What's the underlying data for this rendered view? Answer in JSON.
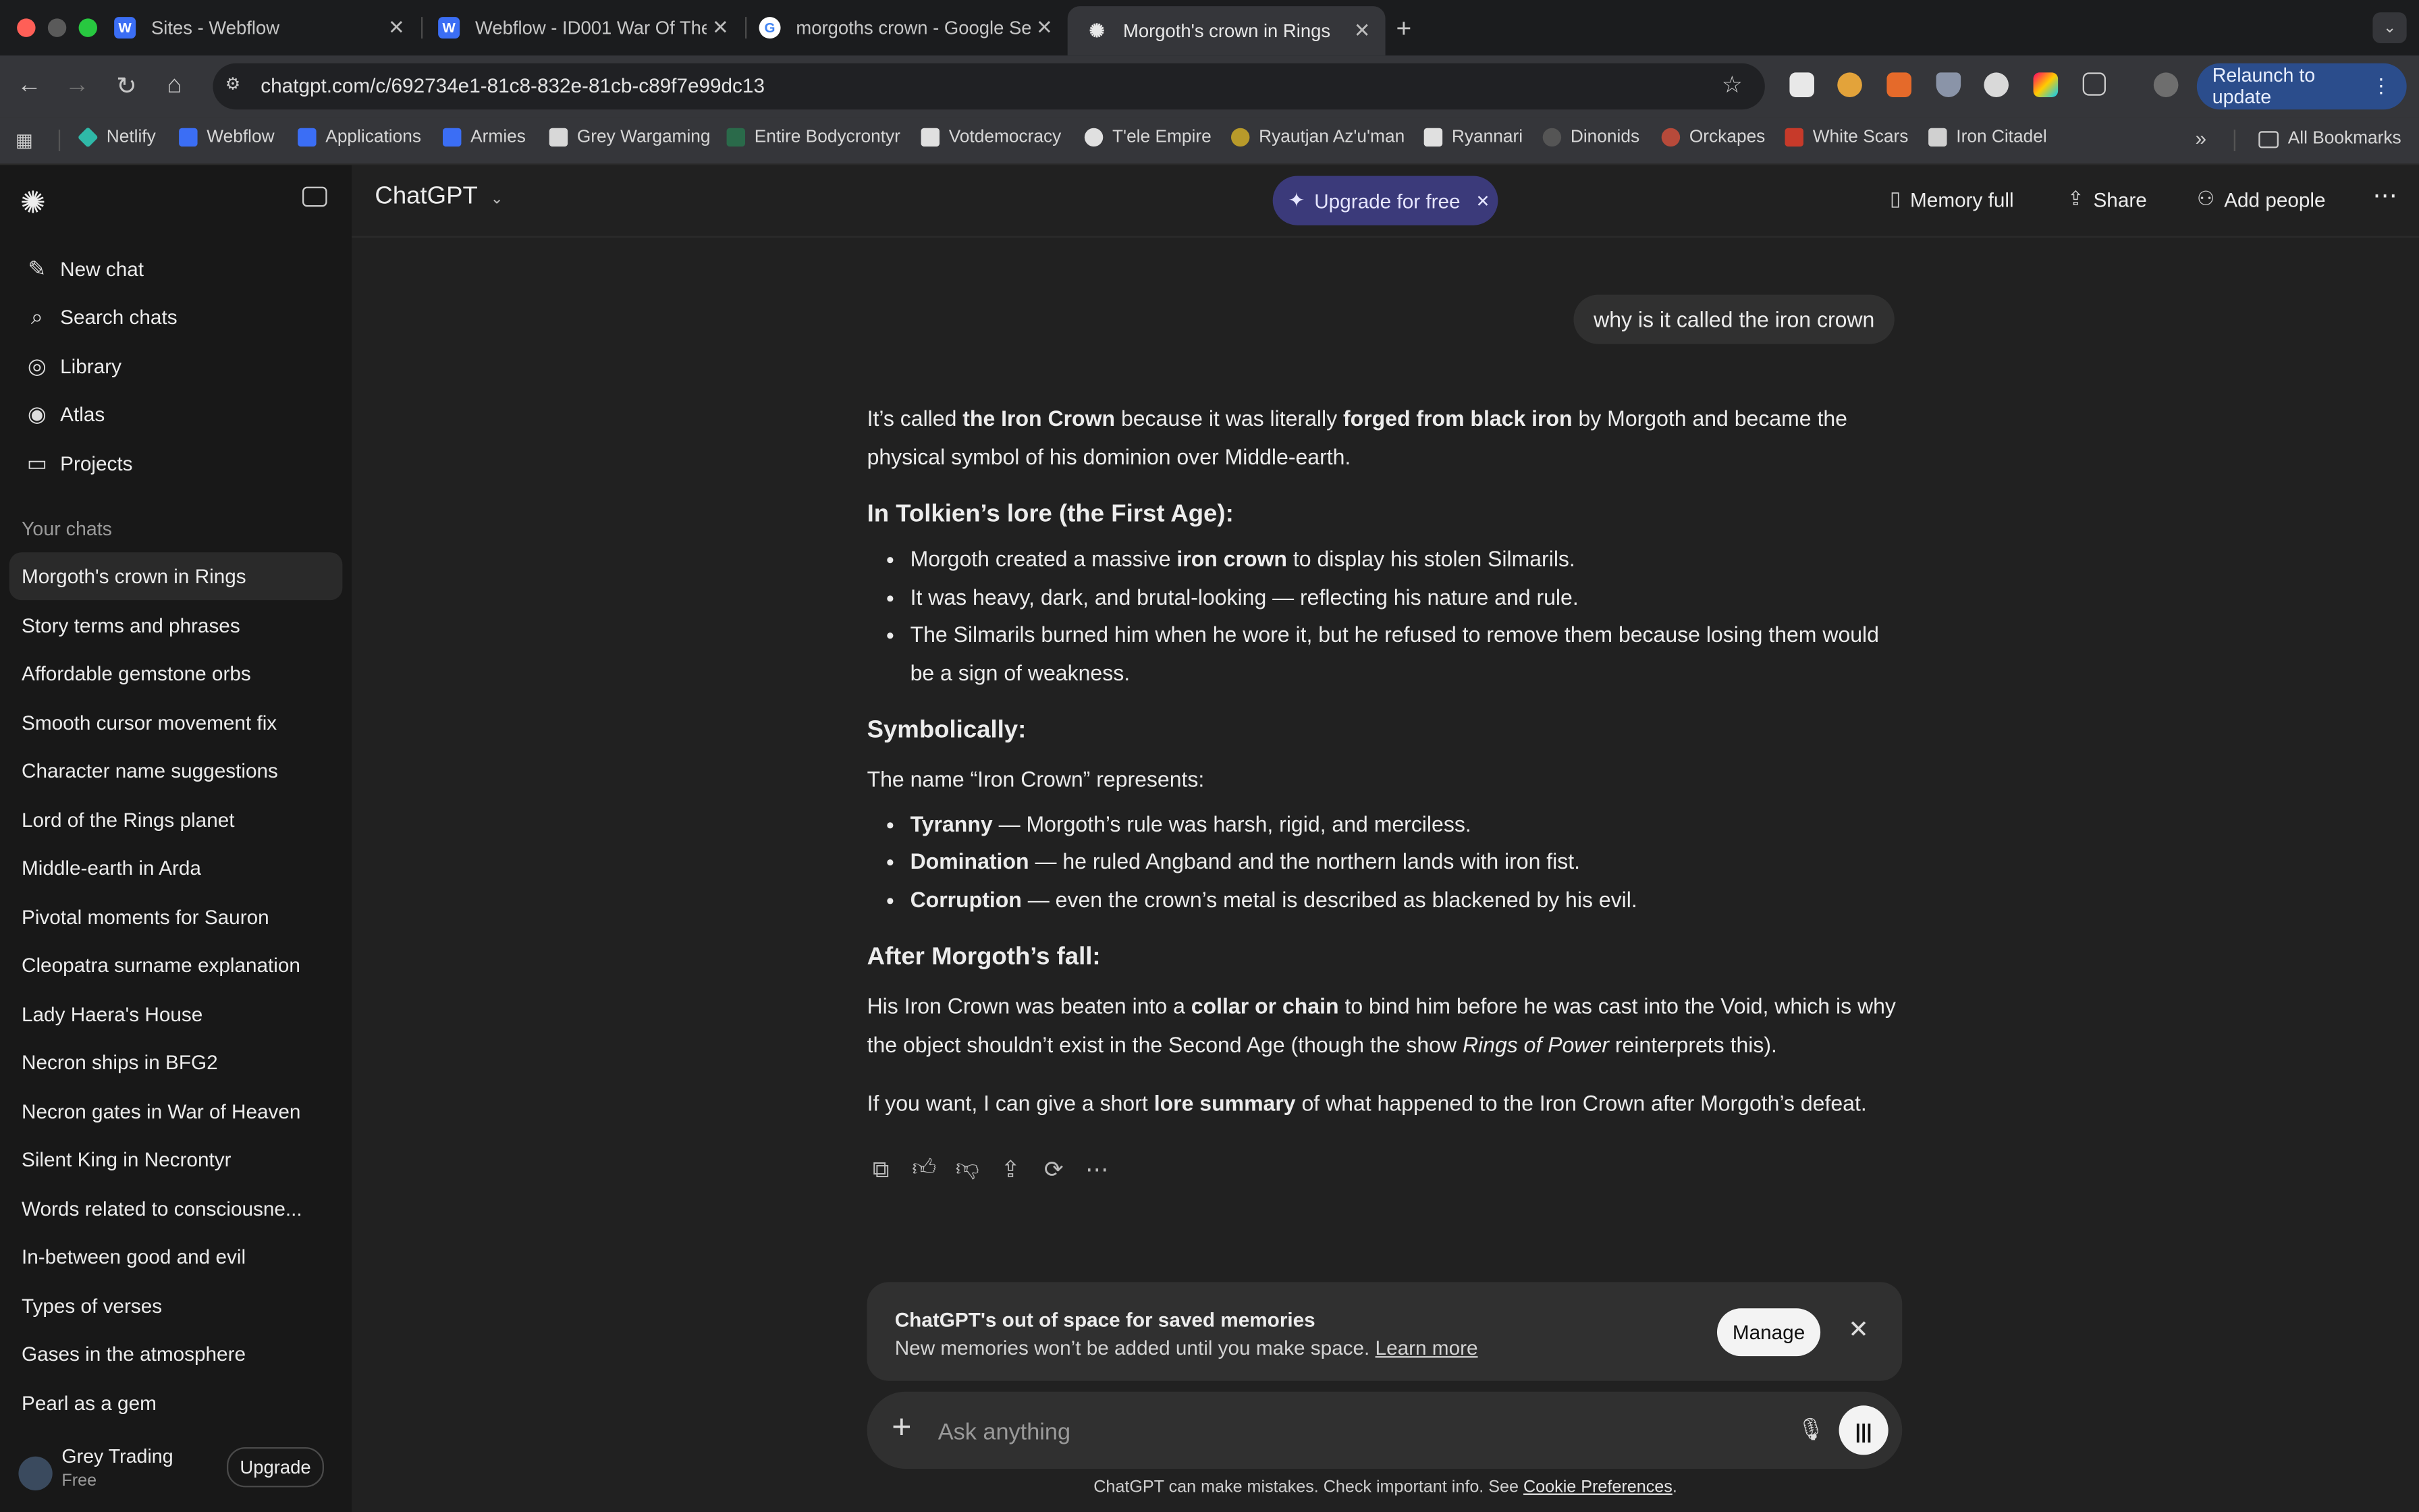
{
  "browser": {
    "tabs": [
      {
        "title": "Sites - Webflow",
        "active": false
      },
      {
        "title": "Webflow - ID001 War Of The ",
        "active": false
      },
      {
        "title": "morgoths crown - Google Sea",
        "active": false
      },
      {
        "title": "Morgoth's crown in Rings",
        "active": true
      }
    ],
    "url": "chatgpt.com/c/692734e1-81c8-832e-81cb-c89f7e99dc13",
    "relaunch_label": "Relaunch to update",
    "bookmarks": [
      "Netlify",
      "Webflow",
      "Applications",
      "Armies",
      "Grey Wargaming",
      "Entire Bodycrontyr",
      "Votdemocracy",
      "T'ele Empire",
      "Ryautjan Az'u'man",
      "Ryannari",
      "Dinonids",
      "Orckapes",
      "White Scars",
      "Iron Citadel"
    ],
    "all_bookmarks": "All Bookmarks",
    "overflow": "»"
  },
  "sidebar": {
    "nav": [
      {
        "label": "New chat",
        "icon": "edit-icon"
      },
      {
        "label": "Search chats",
        "icon": "search-icon"
      },
      {
        "label": "Library",
        "icon": "library-icon"
      },
      {
        "label": "Atlas",
        "icon": "atlas-icon"
      },
      {
        "label": "Projects",
        "icon": "folder-icon"
      }
    ],
    "chats_heading": "Your chats",
    "chats": [
      "Morgoth's crown in Rings",
      "Story terms and phrases",
      "Affordable gemstone orbs",
      "Smooth cursor movement fix",
      "Character name suggestions",
      "Lord of the Rings planet",
      "Middle-earth in Arda",
      "Pivotal moments for Sauron",
      "Cleopatra surname explanation",
      "Lady Haera's House",
      "Necron ships in BFG2",
      "Necron gates in War of Heaven",
      "Silent King in Necrontyr",
      "Words related to consciousne...",
      "In-between good and evil",
      "Types of verses",
      "Gases in the atmosphere",
      "Pearl as a gem"
    ],
    "user": {
      "name": "Grey Trading",
      "plan": "Free",
      "upgrade_label": "Upgrade"
    }
  },
  "header": {
    "model": "ChatGPT",
    "upgrade_pill": "Upgrade for free",
    "memory_full": "Memory full",
    "share": "Share",
    "add_people": "Add people"
  },
  "conversation": {
    "user_message": "why is it called the iron crown",
    "intro_a": "It’s called ",
    "intro_b": "the Iron Crown",
    "intro_c": " because it was literally ",
    "intro_d": "forged from black iron",
    "intro_e": " by Morgoth and became the physical symbol of his dominion over Middle-earth.",
    "h1": "In Tolkien’s lore (the First Age):",
    "l1_a": "Morgoth created a massive ",
    "l1_b": "iron crown",
    "l1_c": " to display his stolen Silmarils.",
    "l2": "It was heavy, dark, and brutal-looking — reflecting his nature and rule.",
    "l3": "The Silmarils burned him when he wore it, but he refused to remove them because losing them would be a sign of weakness.",
    "h2": "Symbolically:",
    "sym_intro": "The name “Iron Crown” represents:",
    "s1_a": "Tyranny",
    "s1_b": " — Morgoth’s rule was harsh, rigid, and merciless.",
    "s2_a": "Domination",
    "s2_b": " — he ruled Angband and the northern lands with iron fist.",
    "s3_a": "Corruption",
    "s3_b": " — even the crown’s metal is described as blackened by his evil.",
    "h3": "After Morgoth’s fall:",
    "after_a": "His Iron Crown was beaten into a ",
    "after_b": "collar or chain",
    "after_c": " to bind him before he was cast into the Void, which is why the object shouldn’t exist in the Second Age (though the show ",
    "after_d": "Rings of Power",
    "after_e": " reinterprets this).",
    "offer_a": "If you want, I can give a short ",
    "offer_b": "lore summary",
    "offer_c": " of what happened to the Iron Crown after Morgoth’s defeat."
  },
  "memory_notice": {
    "title": "ChatGPT's out of space for saved memories",
    "body": "New memories won’t be added until you make space. ",
    "link": "Learn more",
    "manage": "Manage"
  },
  "composer": {
    "placeholder": "Ask anything"
  },
  "disclaimer": {
    "text": "ChatGPT can make mistakes. Check important info. See ",
    "link": "Cookie Preferences",
    "end": "."
  },
  "colors": {
    "upgrade_pill_bg": "#3b3a7a",
    "relaunch_bg": "#2b4d8c",
    "sidebar_bg": "#181818",
    "main_bg": "#212121"
  }
}
